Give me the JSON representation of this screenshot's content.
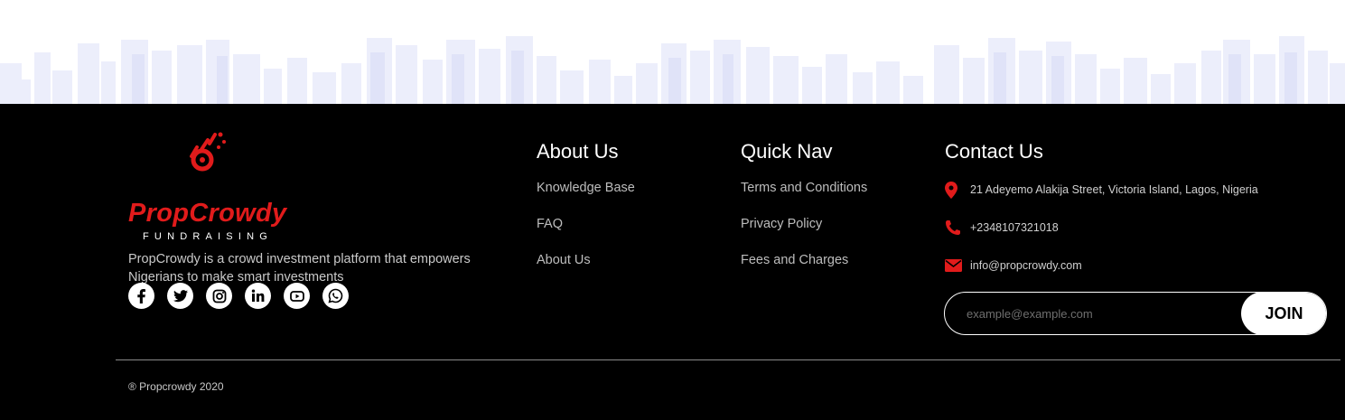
{
  "brand": {
    "name": "PropCrowdy",
    "sub": "FUNDRAISING",
    "tagline": "PropCrowdy is a crowd investment platform that empowers Nigerians to make smart investments",
    "accent": "#e11b1b"
  },
  "socials": [
    {
      "icon": "facebook-icon"
    },
    {
      "icon": "twitter-icon"
    },
    {
      "icon": "instagram-icon"
    },
    {
      "icon": "linkedin-icon"
    },
    {
      "icon": "youtube-icon"
    },
    {
      "icon": "whatsapp-icon"
    }
  ],
  "about": {
    "title": "About Us",
    "links": [
      "Knowledge Base",
      "FAQ",
      "About Us"
    ]
  },
  "quicknav": {
    "title": "Quick Nav",
    "links": [
      "Terms and Conditions",
      "Privacy Policy",
      "Fees and Charges"
    ]
  },
  "contact": {
    "title": "Contact Us",
    "address": "21 Adeyemo Alakija Street, Victoria Island, Lagos, Nigeria",
    "phone": "+2348107321018",
    "email": "info@propcrowdy.com"
  },
  "subscribe": {
    "placeholder": "example@example.com",
    "button": "JOIN"
  },
  "copyright": "® Propcrowdy 2020"
}
